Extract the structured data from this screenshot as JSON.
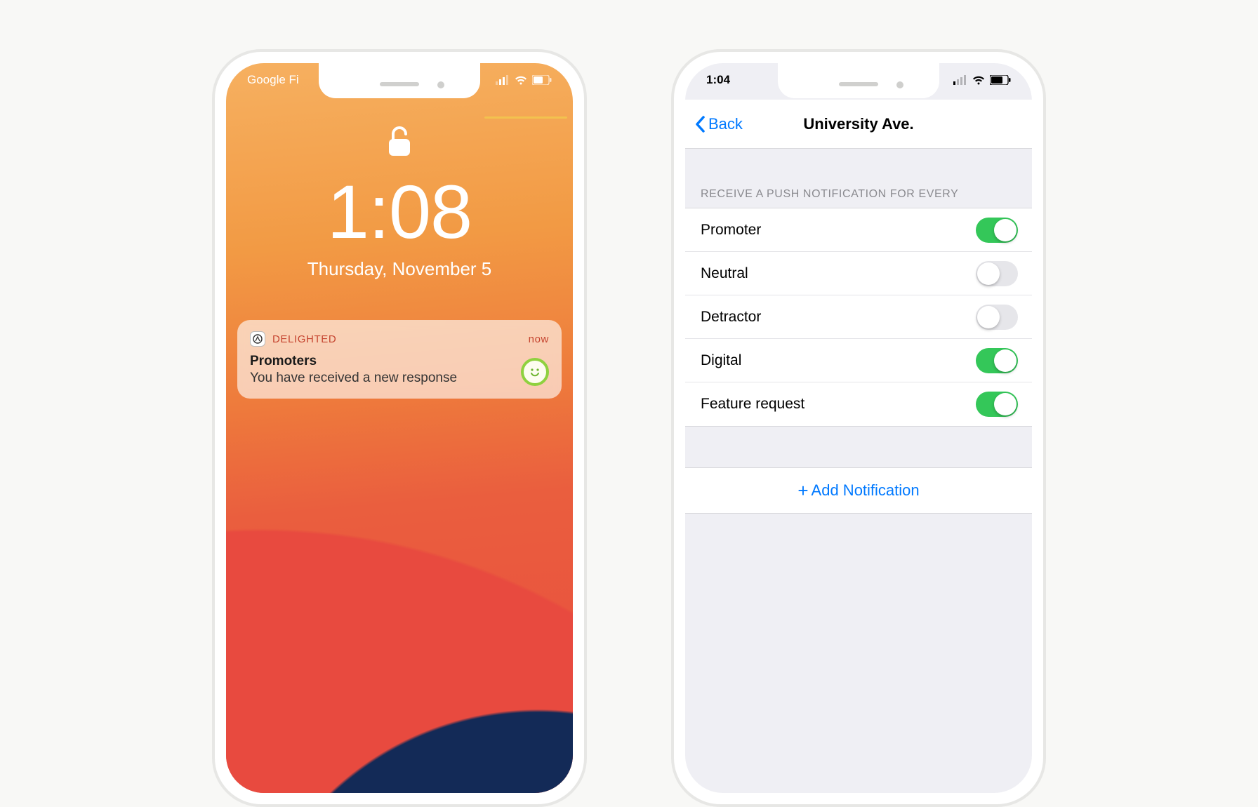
{
  "left_phone": {
    "carrier": "Google Fi",
    "time": "1:08",
    "date": "Thursday, November 5",
    "notification": {
      "app_name": "DELIGHTED",
      "timestamp": "now",
      "title": "Promoters",
      "body": "You have received a new response"
    }
  },
  "right_phone": {
    "status_time": "1:04",
    "nav_back_label": "Back",
    "nav_title": "University Ave.",
    "section_header": "RECEIVE A PUSH NOTIFICATION FOR EVERY",
    "rows": [
      {
        "label": "Promoter",
        "on": true
      },
      {
        "label": "Neutral",
        "on": false
      },
      {
        "label": "Detractor",
        "on": false
      },
      {
        "label": "Digital",
        "on": true
      },
      {
        "label": "Feature request",
        "on": true
      }
    ],
    "add_label": "Add Notification"
  },
  "icons": {
    "unlock": "unlock-icon",
    "smiley": "smiley-icon",
    "chevron_left": "chevron-left-icon",
    "signal": "cell-signal-icon",
    "wifi": "wifi-icon",
    "battery": "battery-icon"
  },
  "colors": {
    "ios_blue": "#0079ff",
    "ios_green": "#34c759"
  }
}
